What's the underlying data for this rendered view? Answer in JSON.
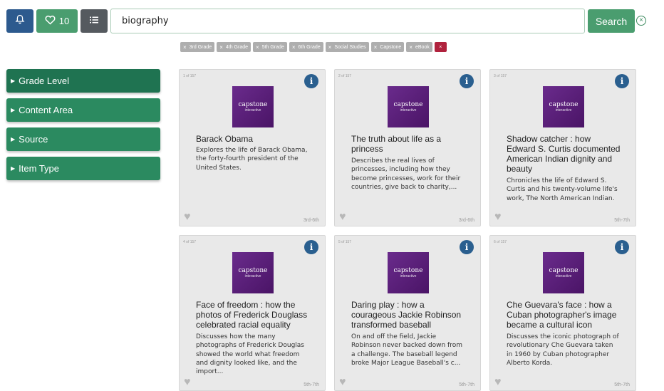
{
  "toolbar": {
    "favorites_count": "10",
    "search_value": "biography",
    "search_label": "Search",
    "clear_symbol": "×"
  },
  "tags": [
    {
      "label": "3rd Grade"
    },
    {
      "label": "4th Grade"
    },
    {
      "label": "5th Grade"
    },
    {
      "label": "6th Grade"
    },
    {
      "label": "Social Studies"
    },
    {
      "label": "Capstone"
    },
    {
      "label": "eBook"
    }
  ],
  "tag_clear": "×",
  "filters": [
    {
      "label": "Grade Level"
    },
    {
      "label": "Content Area"
    },
    {
      "label": "Source"
    },
    {
      "label": "Item Type"
    }
  ],
  "cover": {
    "brand": "capstone",
    "sub": "interactive"
  },
  "results": [
    {
      "index": "1 of 157",
      "title": "Barack Obama",
      "description": "Explores the life of Barack Obama, the forty-fourth president of the United States.",
      "grade": "3rd-6th"
    },
    {
      "index": "2 of 157",
      "title": "The truth about life as a princess",
      "description": "Describes the real lives of princesses, including how they become princesses, work for their countries, give back to charity,...",
      "grade": "3rd-6th"
    },
    {
      "index": "3 of 157",
      "title": "Shadow catcher : how Edward S. Curtis documented American Indian dignity and beauty",
      "description": "Chronicles the life of Edward S. Curtis and his twenty-volume life's work, The North American Indian.",
      "grade": "5th-7th"
    },
    {
      "index": "4 of 157",
      "title": "Face of freedom : how the photos of Frederick Douglass celebrated racial equality",
      "description": "Discusses how the many photographs of Frederick Douglas showed the world what freedom and dignity looked like, and the import...",
      "grade": "5th-7th"
    },
    {
      "index": "5 of 157",
      "title": "Daring play : how a courageous Jackie Robinson transformed baseball",
      "description": "On and off the field, Jackie Robinson never backed down from a challenge. The baseball legend broke Major League Baseball's c...",
      "grade": "5th-7th"
    },
    {
      "index": "6 of 157",
      "title": "Che Guevara's face : how a Cuban photographer's image became a cultural icon",
      "description": "Discusses the iconic photograph of revolutionary Che Guevara taken in 1960 by Cuban photographer Alberto Korda.",
      "grade": "5th-7th"
    }
  ],
  "colors": {
    "primary_blue": "#2d5a8e",
    "green": "#4a9d6f",
    "filter_green": "#2b8a60",
    "tag_gray": "#aeaeae",
    "tag_clear_red": "#b0223d"
  }
}
